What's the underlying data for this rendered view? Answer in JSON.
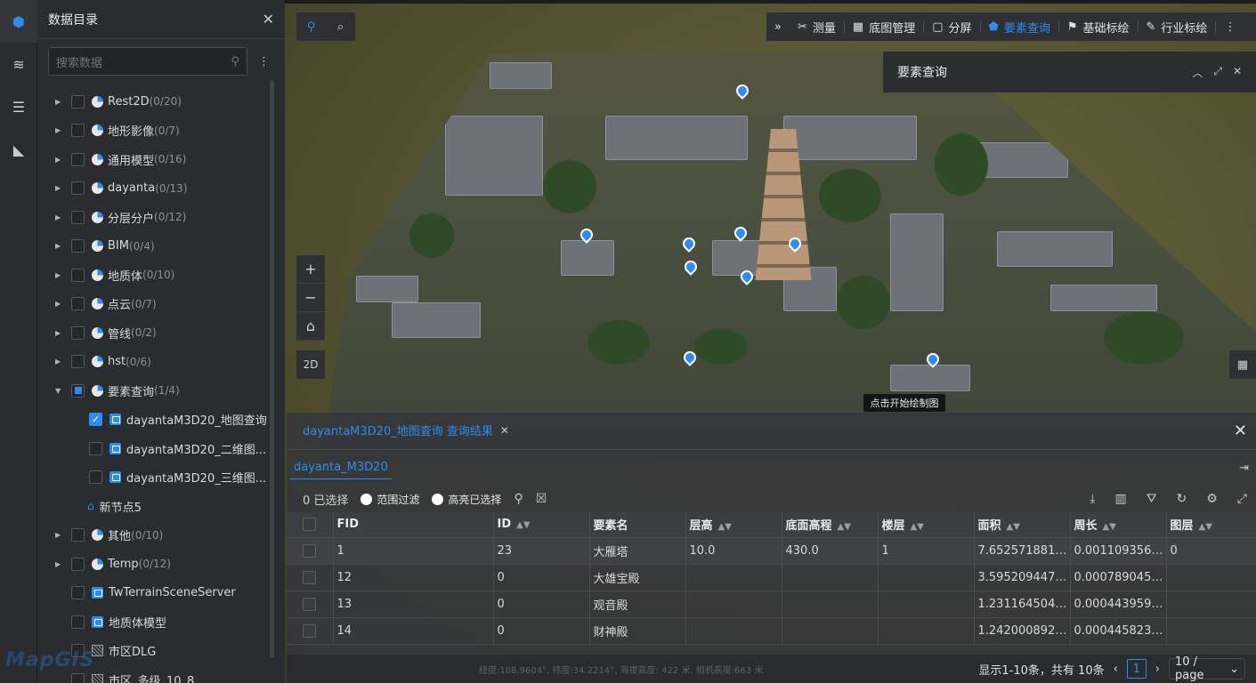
{
  "rail": {
    "icons": [
      "cube-icon",
      "layers-icon",
      "list-icon",
      "ruler-icon"
    ]
  },
  "catalog": {
    "title": "数据目录",
    "search_placeholder": "搜索数据",
    "items": [
      {
        "label": "Rest2D",
        "count": "(0/20)"
      },
      {
        "label": "地形影像",
        "count": "(0/7)"
      },
      {
        "label": "通用模型",
        "count": "(0/16)"
      },
      {
        "label": "dayanta",
        "count": "(0/13)"
      },
      {
        "label": "分层分户",
        "count": "(0/12)"
      },
      {
        "label": "BIM",
        "count": "(0/4)"
      },
      {
        "label": "地质体",
        "count": "(0/10)"
      },
      {
        "label": "点云",
        "count": "(0/7)"
      },
      {
        "label": "管线",
        "count": "(0/2)"
      },
      {
        "label": "hst",
        "count": "(0/6)"
      },
      {
        "label": "要素查询",
        "count": "(1/4)"
      },
      {
        "label": "dayantaM3D20_地图查询"
      },
      {
        "label": "dayantaM3D20_二维图..."
      },
      {
        "label": "dayantaM3D20_三维图..."
      },
      {
        "label": "新节点5"
      },
      {
        "label": "其他",
        "count": "(0/10)"
      },
      {
        "label": "Temp",
        "count": "(0/12)"
      },
      {
        "label": "TwTerrainSceneServer"
      },
      {
        "label": "地质体模型"
      },
      {
        "label": "市区DLG"
      },
      {
        "label": "市区_多级_10_8"
      }
    ]
  },
  "toolbar": {
    "expand": "»",
    "items": [
      {
        "icon": "tools-icon",
        "label": "测量"
      },
      {
        "icon": "grid-icon",
        "label": "底图管理"
      },
      {
        "icon": "split-icon",
        "label": "分屏"
      },
      {
        "icon": "pentagon-icon",
        "label": "要素查询",
        "active": true
      },
      {
        "icon": "pin-icon",
        "label": "基础标绘"
      },
      {
        "icon": "pen-icon",
        "label": "行业标绘"
      }
    ]
  },
  "feature_query": {
    "title": "要素查询"
  },
  "map": {
    "btn_2d": "2D",
    "draw_tip": "点击开始绘制图"
  },
  "results": {
    "tab_label": "dayantaM3D20_地图查询 查询结果",
    "layer": "dayanta_M3D20",
    "selected": "0 已选择",
    "range_filter": "范围过滤",
    "highlight": "高亮已选择",
    "columns": [
      "FID",
      "ID",
      "要素名",
      "层高",
      "底面高程",
      "楼层",
      "面积",
      "周长",
      "图层"
    ],
    "rows": [
      [
        "1",
        "23",
        "大雁塔",
        "10.0",
        "430.0",
        "1",
        "7.6525718812...",
        "0.0011093560...",
        "0"
      ],
      [
        "12",
        "0",
        "大雄宝殿",
        "",
        "",
        "",
        "3.5952094479...",
        "0.0007890451...",
        ""
      ],
      [
        "13",
        "0",
        "观音殿",
        "",
        "",
        "",
        "1.2311645040...",
        "0.0004439594...",
        ""
      ],
      [
        "14",
        "0",
        "财神殿",
        "",
        "",
        "",
        "1.2420008920...",
        "0.0004458239...",
        ""
      ]
    ]
  },
  "status": {
    "coords": "经度:108.9604°, 纬度:34.2214°, 海拔高度: 422 米, 相机高度:663 米",
    "summary": "显示1-10条，共有 10条",
    "page": "1",
    "page_size": "10 / page"
  },
  "logo": "MapGIS",
  "colors": {
    "accent": "#2d8cf0",
    "panel": "#2b2c2f"
  }
}
